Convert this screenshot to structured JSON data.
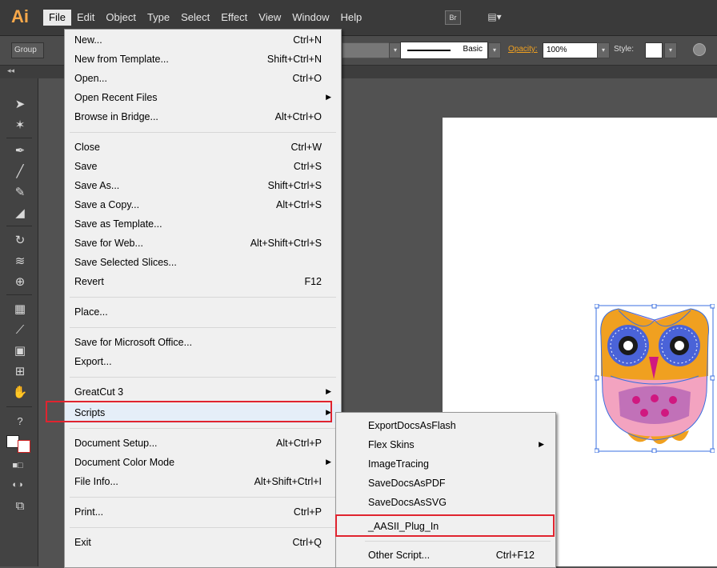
{
  "app": {
    "logo": "Ai"
  },
  "menubar": {
    "items": [
      {
        "label": "File",
        "active": true
      },
      {
        "label": "Edit"
      },
      {
        "label": "Object"
      },
      {
        "label": "Type"
      },
      {
        "label": "Select"
      },
      {
        "label": "Effect"
      },
      {
        "label": "View"
      },
      {
        "label": "Window"
      },
      {
        "label": "Help"
      }
    ],
    "bridge_icon": "Br",
    "arrange_icon": "▤▾"
  },
  "controlbar": {
    "group_label": "Group",
    "stroke_profile": "Basic",
    "opacity_label": "Opacity:",
    "opacity_value": "100%",
    "style_label": "Style:"
  },
  "tabstrip": {
    "collapse": "◂◂"
  },
  "file_menu": {
    "items": [
      {
        "label": "New...",
        "shortcut": "Ctrl+N"
      },
      {
        "label": "New from Template...",
        "shortcut": "Shift+Ctrl+N"
      },
      {
        "label": "Open...",
        "shortcut": "Ctrl+O"
      },
      {
        "label": "Open Recent Files",
        "shortcut": "",
        "submenu": true
      },
      {
        "label": "Browse in Bridge...",
        "shortcut": "Alt+Ctrl+O"
      },
      {
        "label": "Close",
        "shortcut": "Ctrl+W"
      },
      {
        "label": "Save",
        "shortcut": "Ctrl+S"
      },
      {
        "label": "Save As...",
        "shortcut": "Shift+Ctrl+S"
      },
      {
        "label": "Save a Copy...",
        "shortcut": "Alt+Ctrl+S"
      },
      {
        "label": "Save as Template...",
        "shortcut": ""
      },
      {
        "label": "Save for Web...",
        "shortcut": "Alt+Shift+Ctrl+S"
      },
      {
        "label": "Save Selected Slices...",
        "shortcut": ""
      },
      {
        "label": "Revert",
        "shortcut": "F12"
      },
      {
        "label": "Place...",
        "shortcut": ""
      },
      {
        "label": "Save for Microsoft Office...",
        "shortcut": ""
      },
      {
        "label": "Export...",
        "shortcut": ""
      },
      {
        "label": "GreatCut 3",
        "shortcut": "",
        "submenu": true
      },
      {
        "label": "Scripts",
        "shortcut": "",
        "submenu": true
      },
      {
        "label": "Document Setup...",
        "shortcut": "Alt+Ctrl+P"
      },
      {
        "label": "Document Color Mode",
        "shortcut": "",
        "submenu": true
      },
      {
        "label": "File Info...",
        "shortcut": "Alt+Shift+Ctrl+I"
      },
      {
        "label": "Print...",
        "shortcut": "Ctrl+P"
      },
      {
        "label": "Exit",
        "shortcut": "Ctrl+Q"
      }
    ]
  },
  "scripts_menu": {
    "items": [
      {
        "label": "ExportDocsAsFlash",
        "shortcut": ""
      },
      {
        "label": "Flex Skins",
        "shortcut": "",
        "submenu": true
      },
      {
        "label": "ImageTracing",
        "shortcut": ""
      },
      {
        "label": "SaveDocsAsPDF",
        "shortcut": ""
      },
      {
        "label": "SaveDocsAsSVG",
        "shortcut": ""
      },
      {
        "label": "_AASII_Plug_In",
        "shortcut": ""
      },
      {
        "label": "Other Script...",
        "shortcut": "Ctrl+F12"
      }
    ]
  },
  "colors": {
    "highlight_border": "#e0242f",
    "accent_orange": "#f0a020",
    "selection_blue": "#3a6fe0"
  }
}
